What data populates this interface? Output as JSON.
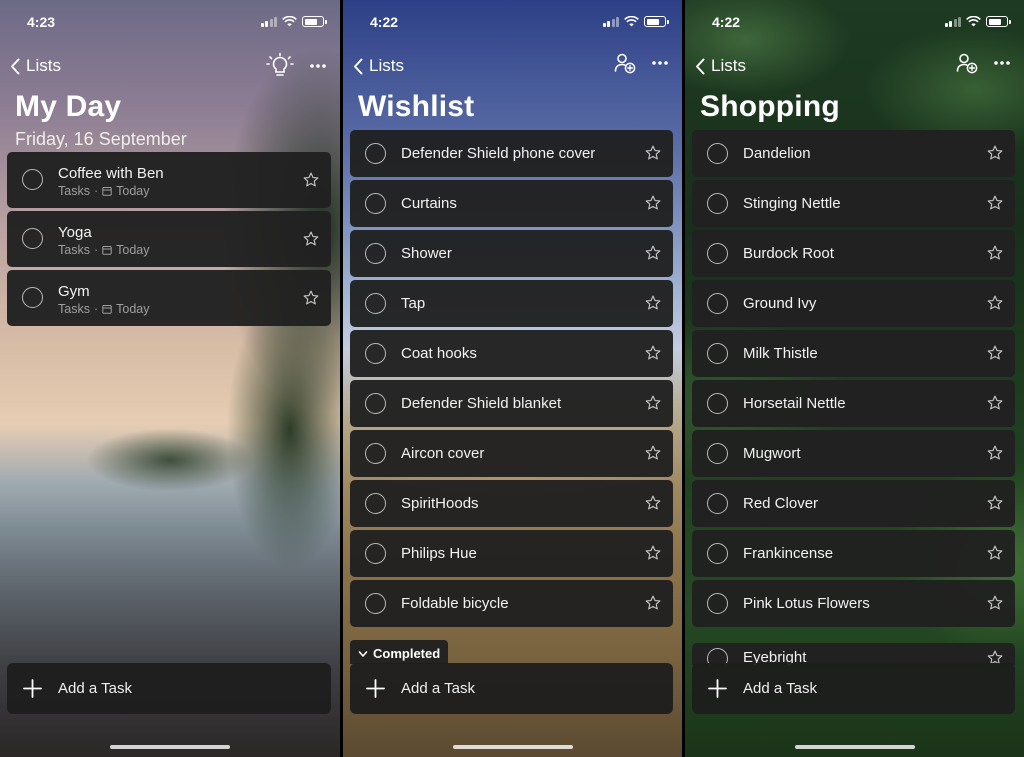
{
  "status": {
    "myday_time": "4:23",
    "wishlist_time": "4:22",
    "shopping_time": "4:22"
  },
  "nav": {
    "back_label": "Lists"
  },
  "myday": {
    "title": "My Day",
    "date": "Friday, 16 September",
    "tasks": [
      {
        "name": "Coffee with Ben",
        "list": "Tasks",
        "due": "Today"
      },
      {
        "name": "Yoga",
        "list": "Tasks",
        "due": "Today"
      },
      {
        "name": "Gym",
        "list": "Tasks",
        "due": "Today"
      }
    ]
  },
  "wishlist": {
    "title": "Wishlist",
    "tasks": [
      "Defender Shield phone cover",
      "Curtains",
      "Shower",
      "Tap",
      "Coat hooks",
      "Defender Shield blanket",
      "Aircon cover",
      "SpiritHoods",
      "Philips Hue",
      "Foldable bicycle"
    ],
    "completed_label": "Completed"
  },
  "shopping": {
    "title": "Shopping",
    "tasks": [
      "Dandelion",
      "Stinging Nettle",
      "Burdock Root",
      "Ground Ivy",
      "Milk Thistle",
      "Horsetail Nettle",
      "Mugwort",
      "Red Clover",
      "Frankincense",
      "Pink Lotus Flowers"
    ],
    "partial_item": "Eyebright"
  },
  "add_task_label": "Add a Task"
}
